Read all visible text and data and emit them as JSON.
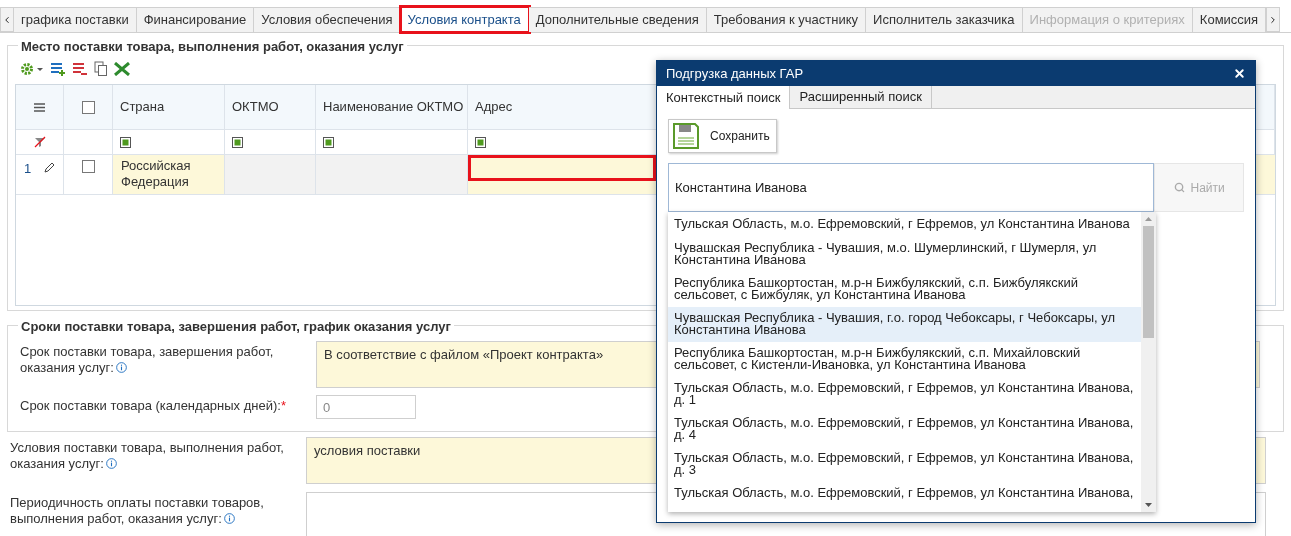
{
  "tab_bar": {
    "tabs": [
      {
        "label": "графика поставки",
        "selected": false,
        "disabled": false,
        "highlighted": false
      },
      {
        "label": "Финансирование",
        "selected": false,
        "disabled": false,
        "highlighted": false
      },
      {
        "label": "Условия обеспечения",
        "selected": false,
        "disabled": false,
        "highlighted": false
      },
      {
        "label": "Условия контракта",
        "selected": true,
        "disabled": false,
        "highlighted": true
      },
      {
        "label": "Дополнительные сведения",
        "selected": false,
        "disabled": false,
        "highlighted": false
      },
      {
        "label": "Требования к участнику",
        "selected": false,
        "disabled": false,
        "highlighted": false
      },
      {
        "label": "Исполнитель заказчика",
        "selected": false,
        "disabled": false,
        "highlighted": false
      },
      {
        "label": "Информация о критериях",
        "selected": false,
        "disabled": true,
        "highlighted": false
      },
      {
        "label": "Комиссия",
        "selected": false,
        "disabled": false,
        "highlighted": false
      }
    ]
  },
  "delivery_place": {
    "title": "Место поставки товара, выполнения работ, оказания услуг",
    "table": {
      "columns": [
        "Страна",
        "ОКТМО",
        "Наименование ОКТМО",
        "Адрес"
      ],
      "header_checked": false,
      "rows": [
        {
          "number": "1",
          "checked": false,
          "country": "Российская Федерация",
          "address_highlighted": true
        }
      ]
    }
  },
  "delivery_terms": {
    "title": "Сроки поставки товара, завершения работ, график оказания услуг",
    "fields": [
      {
        "kind": "textarea",
        "label": "Срок поставки товара, завершения работ, оказания услуг:",
        "info": true,
        "value": "В соответствие с файлом «Проект контракта»"
      },
      {
        "kind": "number",
        "label": "Срок поставки товара (календарных дней):",
        "info": false,
        "required_mark": "*",
        "placeholder": "0"
      }
    ]
  },
  "fields": [
    {
      "kind": "textarea",
      "label": "Условия поставки товара, выполнения работ, оказания услуг:",
      "info": true,
      "value": "условия поставки"
    },
    {
      "kind": "textarea",
      "label": "Периодичность оплаты поставки товаров, выполнения работ, оказания услуг:",
      "info": true
    }
  ],
  "dialog": {
    "title": "Подгрузка данных ГАР",
    "tabs": [
      {
        "label": "Контекстный поиск",
        "selected": true
      },
      {
        "label": "Расширенный поиск",
        "selected": false
      }
    ],
    "save_label": "Сохранить",
    "search": {
      "value": "Константина Иванова"
    },
    "find_button": {
      "label": "Найти",
      "disabled": true
    },
    "suggestions": [
      {
        "text": "Тульская Область, м.о. Ефремовский, г Ефремов, ул Константина Иванова",
        "selected": false
      },
      {
        "text": "Чувашская Республика - Чувашия, м.о. Шумерлинский, г Шумерля, ул Константина Иванова",
        "selected": false
      },
      {
        "text": "Республика Башкортостан, м.р-н Бижбулякский, с.п. Бижбулякский сельсовет, с Бижбуляк, ул Константина Иванова",
        "selected": false
      },
      {
        "text": "Чувашская Республика - Чувашия, г.о. город Чебоксары, г Чебоксары, ул Константина Иванова",
        "selected": true
      },
      {
        "text": "Республика Башкортостан, м.р-н Бижбулякский, с.п. Михайловский сельсовет, с Кистенли-Ивановка, ул Константина Иванова",
        "selected": false
      },
      {
        "text": "Тульская Область, м.о. Ефремовский, г Ефремов, ул Константина Иванова, д. 1",
        "selected": false
      },
      {
        "text": "Тульская Область, м.о. Ефремовский, г Ефремов, ул Константина Иванова, д. 4",
        "selected": false
      },
      {
        "text": "Тульская Область, м.о. Ефремовский, г Ефремов, ул Константина Иванова, д. 3",
        "selected": false
      },
      {
        "text": "Тульская Область, м.о. Ефремовский, г Ефремов, ул Константина Иванова,",
        "selected": false
      }
    ]
  }
}
